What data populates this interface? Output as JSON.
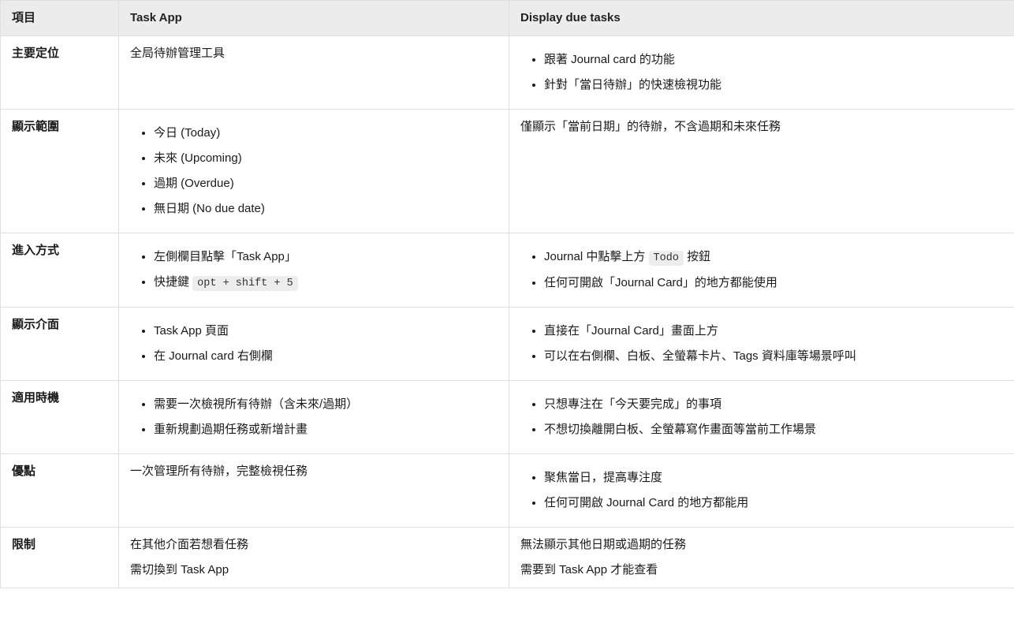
{
  "headers": {
    "item": "項目",
    "taskapp": "Task App",
    "display": "Display due tasks"
  },
  "rows": {
    "r0": {
      "label": "主要定位",
      "taskapp_text": "全局待辦管理工具",
      "display_list": {
        "0": "跟著 Journal card 的功能",
        "1": "針對「當日待辦」的快速檢視功能"
      }
    },
    "r1": {
      "label": "顯示範圍",
      "taskapp_list": {
        "0": "今日 (Today)",
        "1": "未來 (Upcoming)",
        "2": "過期 (Overdue)",
        "3": "無日期 (No due date)"
      },
      "display_text": "僅顯示「當前日期」的待辦，不含過期和未來任務"
    },
    "r2": {
      "label": "進入方式",
      "taskapp_list": {
        "0": "左側欄目點擊「Task App」",
        "1_prefix": "快捷鍵 ",
        "1_code": "opt + shift + 5"
      },
      "display_list": {
        "0_prefix": "Journal 中點擊上方 ",
        "0_code": "Todo",
        "0_suffix": " 按鈕",
        "1": "任何可開啟「Journal Card」的地方都能使用"
      }
    },
    "r3": {
      "label": "顯示介面",
      "taskapp_list": {
        "0": "Task App 頁面",
        "1": "在 Journal card 右側欄"
      },
      "display_list": {
        "0": "直接在「Journal Card」畫面上方",
        "1": "可以在右側欄、白板、全螢幕卡片、Tags 資料庫等場景呼叫"
      }
    },
    "r4": {
      "label": "適用時機",
      "taskapp_list": {
        "0": "需要一次檢視所有待辦（含未來/過期）",
        "1": "重新規劃過期任務或新增計畫"
      },
      "display_list": {
        "0": "只想專注在「今天要完成」的事項",
        "1": "不想切換離開白板、全螢幕寫作畫面等當前工作場景"
      }
    },
    "r5": {
      "label": "優點",
      "taskapp_text": "一次管理所有待辦，完整檢視任務",
      "display_list": {
        "0": "聚焦當日，提高專注度",
        "1": "任何可開啟 Journal Card 的地方都能用"
      }
    },
    "r6": {
      "label": "限制",
      "taskapp_lines": {
        "0": "在其他介面若想看任務",
        "1": "需切換到 Task App"
      },
      "display_lines": {
        "0": "無法顯示其他日期或過期的任務",
        "1": "需要到 Task App 才能查看"
      }
    }
  }
}
